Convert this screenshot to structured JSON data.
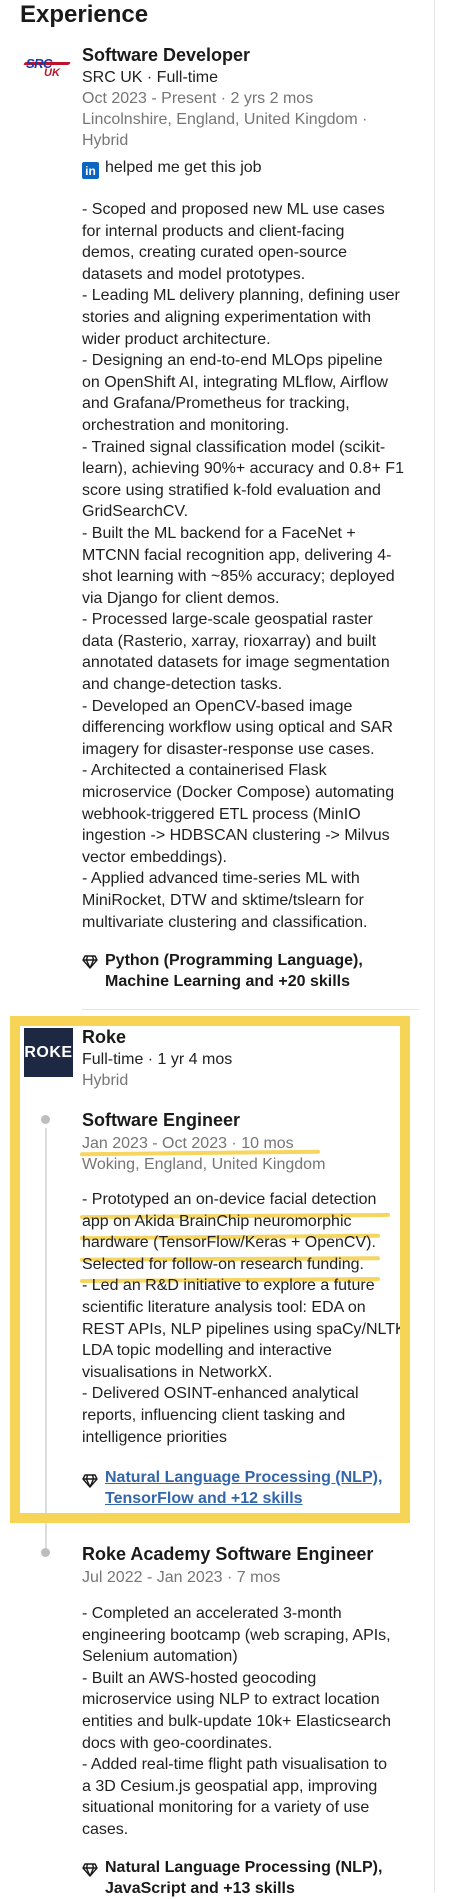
{
  "section": {
    "title": "Experience"
  },
  "job1": {
    "logo_text_top": "SRC",
    "logo_text_bottom": "UK",
    "title": "Software Developer",
    "company": "SRC UK · Full-time",
    "dates": "Oct 2023 - Present · 2 yrs 2 mos",
    "location_line1": "Lincolnshire, England, United Kingdom ·",
    "location_line2": "Hybrid",
    "linkedin_badge": "in",
    "linkedin_text": "helped me get this job",
    "description": "- Scoped and proposed new ML use cases\nfor internal products and client-facing\ndemos, creating curated open-source\ndatasets and model prototypes.\n- Leading ML delivery planning, defining user\nstories and aligning experimentation with\nwider product architecture.\n- Designing an end-to-end MLOps pipeline\non OpenShift AI, integrating MLflow, Airflow\nand Grafana/Prometheus for tracking,\norchestration and monitoring.\n- Trained signal classification model (scikit-\nlearn), achieving 90%+ accuracy and 0.8+ F1\nscore using stratified k-fold evaluation and\nGridSearchCV.\n- Built the ML backend for a FaceNet +\nMTCNN facial recognition app, delivering 4-\nshot learning with ~85% accuracy; deployed\nvia Django for client demos.\n- Processed large-scale geospatial raster\ndata (Rasterio, xarray, rioxarray) and built\nannotated datasets for image segmentation\nand change-detection tasks.\n- Developed an OpenCV-based image\ndifferencing workflow using optical and SAR\nimagery for disaster-response use cases.\n- Architected a containerised Flask\nmicroservice (Docker Compose) automating\nwebhook-triggered ETL process (MinIO\ningestion -> HDBSCAN clustering -> Milvus\nvector embeddings).\n- Applied advanced time-series ML with\nMiniRocket, DTW and sktime/tslearn for\nmultivariate clustering and classification.",
    "skills": "Python (Programming Language),\nMachine Learning and +20 skills"
  },
  "job2": {
    "logo_text": "ROKE",
    "company": "Roke",
    "tenure": "Full-time · 1 yr 4 mos",
    "work_mode": "Hybrid",
    "role1": {
      "title": "Software Engineer",
      "dates": "Jan 2023 - Oct 2023 · 10 mos",
      "location": "Woking, England, United Kingdom",
      "description": "- Prototyped an on-device facial detection\napp on Akida BrainChip neuromorphic\nhardware (TensorFlow/Keras + OpenCV).\nSelected for follow-on research funding.\n- Led an R&D initiative to explore a future\nscientific literature analysis tool: EDA on\nREST APIs, NLP pipelines using spaCy/NLTK,\nLDA topic modelling and interactive\nvisualisations in NetworkX.\n- Delivered OSINT-enhanced analytical\nreports, influencing client tasking and\nintelligence priorities",
      "skills": "Natural Language Processing (NLP),\nTensorFlow and +12 skills"
    },
    "role2": {
      "title": "Roke Academy Software Engineer",
      "dates": "Jul 2022 - Jan 2023 · 7 mos",
      "description": "- Completed an accelerated 3-month\nengineering bootcamp (web scraping, APIs,\nSelenium automation)\n- Built an AWS-hosted geocoding\nmicroservice using NLP to extract location\nentities and bulk-update 10k+ Elasticsearch\ndocs with geo-coordinates.\n- Added real-time flight path visualisation to\na 3D Cesium.js geospatial app, improving\nsituational monitoring for a variety of use\ncases.",
      "skills": "Natural Language Processing (NLP),\nJavaScript and +13 skills"
    }
  },
  "colors": {
    "highlight": "#f6d455",
    "linkedin_blue": "#0a66c2",
    "roke_navy": "#1d2942",
    "src_blue": "#1a3aa8",
    "src_red": "#c0122a",
    "link_blue": "#3366aa"
  },
  "icons": {
    "skills": "diamond-gem-icon",
    "linkedin": "linkedin-logo-icon",
    "timeline": "timeline-dot-icon"
  }
}
